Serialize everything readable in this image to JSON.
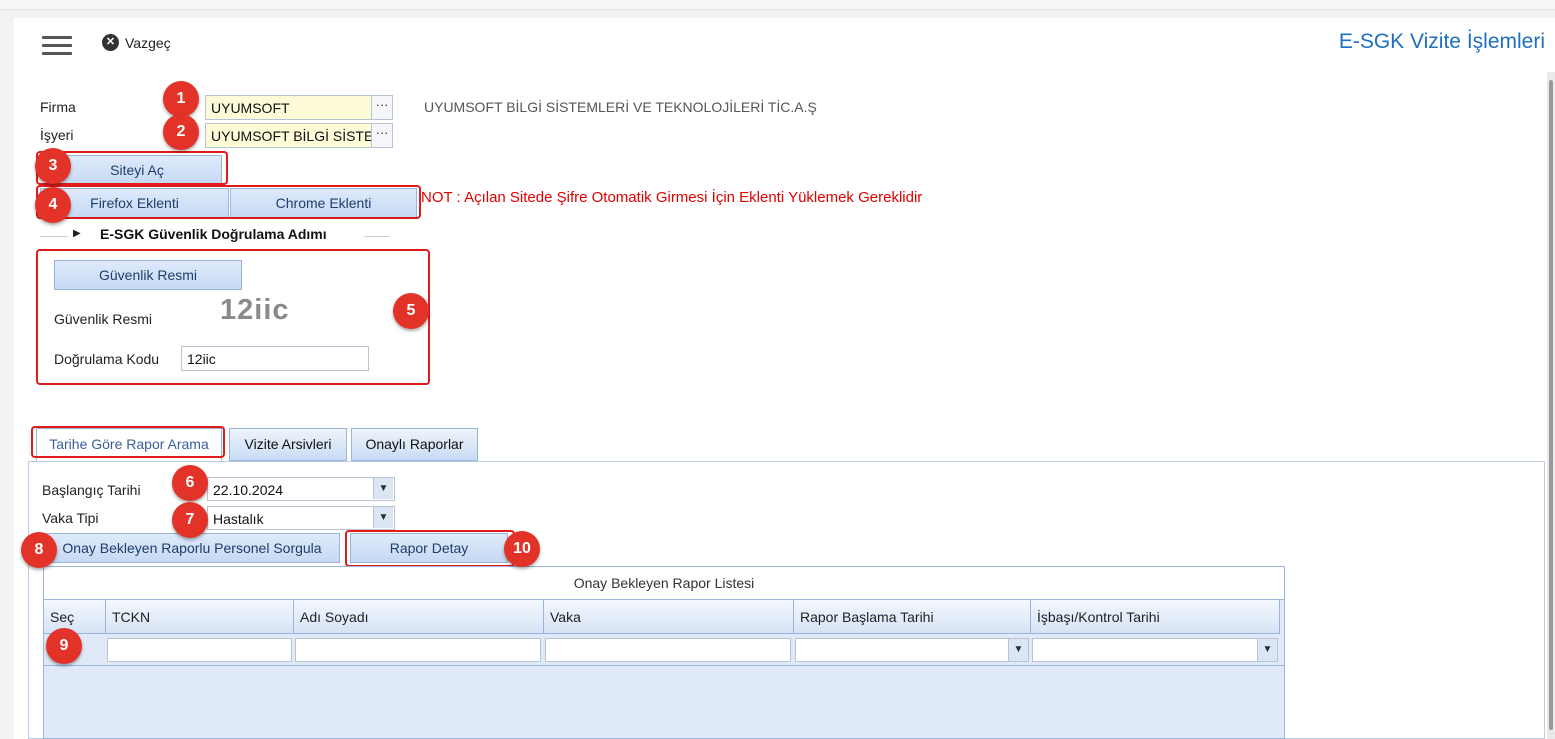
{
  "header": {
    "cancel_label": "Vazgeç",
    "cancel_icon": "close-circle-icon",
    "menu_icon": "hamburger-menu-icon",
    "title": "E-SGK Vizite İşlemleri"
  },
  "form": {
    "firma_label": "Firma",
    "firma_value": "UYUMSOFT",
    "firma_desc": "UYUMSOFT BİLGİ SİSTEMLERİ VE TEKNOLOJİLERİ TİC.A.Ş",
    "isyeri_label": "İşyeri",
    "isyeri_value": "UYUMSOFT BİLGİ SİSTEMLERİ",
    "lookup_label": "···",
    "open_site_button": "Siteyi Aç",
    "firefox_button": "Firefox Eklenti",
    "chrome_button": "Chrome Eklenti",
    "note": "NOT : Açılan Sitede Şifre Otomatik Girmesi İçin Eklenti Yüklemek Gereklidir"
  },
  "security": {
    "section_title": "E-SGK Güvenlik Doğrulama Adımı",
    "image_button": "Güvenlik Resmi",
    "image_label": "Güvenlik Resmi",
    "captcha_text": "12iic",
    "code_label": "Doğrulama Kodu",
    "code_value": "12iic"
  },
  "tabs": [
    {
      "label": "Tarihe Göre Rapor Arama",
      "active": true
    },
    {
      "label": "Vizite Arsivleri",
      "active": false
    },
    {
      "label": "Onaylı Raporlar",
      "active": false
    }
  ],
  "search": {
    "start_date_label": "Başlangıç Tarihi",
    "start_date_value": "22.10.2024",
    "case_type_label": "Vaka Tipi",
    "case_type_value": "Hastalık",
    "query_button": "Onay Bekleyen Raporlu Personel Sorgula",
    "detail_button": "Rapor Detay"
  },
  "grid": {
    "caption": "Onay Bekleyen Rapor Listesi",
    "columns": [
      "Seç",
      "TCKN",
      "Adı Soyadı",
      "Vaka",
      "Rapor Başlama Tarihi",
      "İşbaşı/Kontrol Tarihi"
    ]
  },
  "badges": [
    "1",
    "2",
    "3",
    "4",
    "5",
    "6",
    "7",
    "8",
    "9",
    "10"
  ],
  "colors": {
    "title_blue": "#1f6fc0",
    "annotation_red": "#e33228",
    "note_red": "#e00000",
    "button_blue": "#c6d9f3"
  }
}
